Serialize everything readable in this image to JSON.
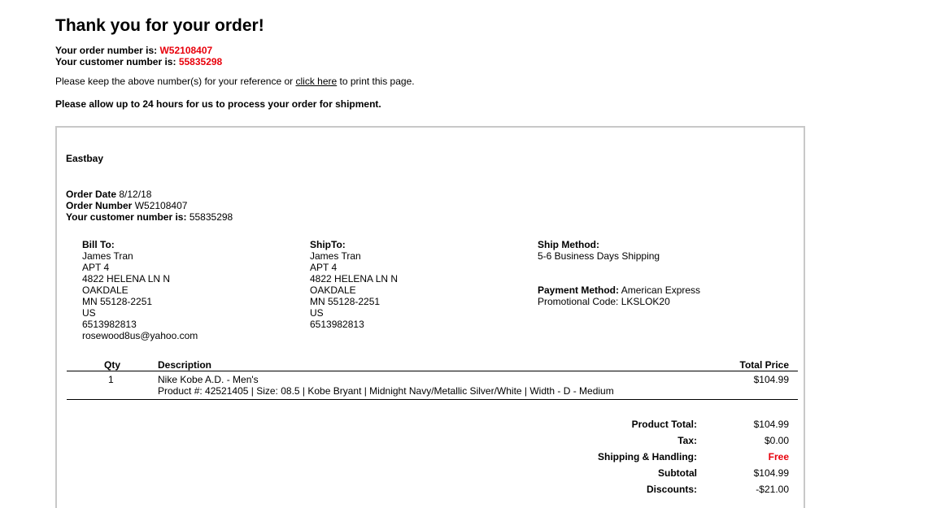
{
  "header": {
    "title": "Thank you for your order!",
    "order_number_label": "Your order number is:",
    "order_number": "W52108407",
    "customer_number_label": "Your customer number is:",
    "customer_number": "55835298",
    "reference_before": "Please keep the above number(s) for your reference or",
    "print_link": "click here",
    "reference_after": "to print this page.",
    "processing_note": "Please allow up to 24 hours for us to process your order for shipment."
  },
  "receipt": {
    "store": "Eastbay",
    "order_date_label": "Order Date",
    "order_date": "8/12/18",
    "order_number_label": "Order Number",
    "order_number": "W52108407",
    "customer_number_label": "Your customer number is:",
    "customer_number": "55835298",
    "bill_to": {
      "label": "Bill To:",
      "lines": [
        "James Tran",
        "APT 4",
        "4822 HELENA LN N",
        "OAKDALE",
        "MN 55128-2251",
        "US",
        "6513982813",
        "rosewood8us@yahoo.com"
      ]
    },
    "ship_to": {
      "label": "ShipTo:",
      "lines": [
        "James Tran",
        "APT 4",
        "4822 HELENA LN N",
        "OAKDALE",
        "MN 55128-2251",
        "US",
        "6513982813"
      ]
    },
    "ship_method_label": "Ship Method:",
    "ship_method": "5-6 Business Days Shipping",
    "payment_method_label": "Payment Method:",
    "payment_method": "American Express",
    "promo_label": "Promotional Code:",
    "promo_code": "LKSLOK20",
    "table": {
      "headers": {
        "qty": "Qty",
        "description": "Description",
        "total": "Total Price"
      },
      "items": [
        {
          "qty": "1",
          "name": "Nike Kobe A.D. - Men's",
          "details": "Product #: 42521405 | Size: 08.5 | Kobe Bryant | Midnight Navy/Metallic Silver/White | Width - D - Medium",
          "price": "$104.99"
        }
      ]
    },
    "totals": [
      {
        "label": "Product Total:",
        "value": "$104.99"
      },
      {
        "label": "Tax:",
        "value": "$0.00"
      },
      {
        "label": "Shipping & Handling:",
        "value": "Free"
      },
      {
        "label": "Subtotal",
        "value": "$104.99"
      },
      {
        "label": "Discounts:",
        "value": "-$21.00"
      }
    ]
  },
  "colors": {
    "accent_red": "#e8000b",
    "frame_border": "#c8c8c8"
  }
}
